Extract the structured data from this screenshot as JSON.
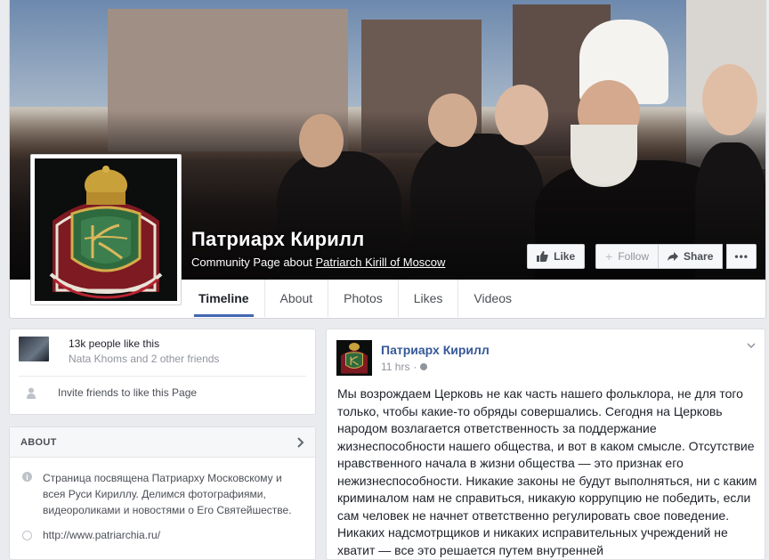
{
  "page": {
    "name": "Патриарх Кирилл",
    "subtitle_prefix": "Community Page about",
    "subtitle_link": "Patriarch Kirill of Moscow"
  },
  "actions": {
    "like": "Like",
    "follow": "Follow",
    "share": "Share",
    "more": "•••"
  },
  "tabs": [
    {
      "label": "Timeline",
      "active": true
    },
    {
      "label": "About"
    },
    {
      "label": "Photos"
    },
    {
      "label": "Likes"
    },
    {
      "label": "Videos"
    }
  ],
  "likes": {
    "count": "13k people like this",
    "friends": "Nata Khoms and 2 other friends",
    "invite": "Invite friends to like this Page"
  },
  "about": {
    "title": "ABOUT",
    "description": "Страница посвящена Патриарху Московскому и всея Руси Кириллу. Делимся фотографиями, видеороликами и новостями о Его Святейшестве.",
    "website": "http://www.patriarchia.ru/"
  },
  "post": {
    "author": "Патриарх Кирилл",
    "time": "11 hrs",
    "separator": "·",
    "text": "Мы возрождаем Церковь не как часть нашего фольклора, не для того только, чтобы какие-то обряды совершались. Сегодня на Церковь народом возлагается ответственность за поддержание жизнеспособности нашего общества, и вот в каком смысле. Отсутствие нравственного начала в жизни общества — это признак его нежизнеспособности. Никакие законы не будут выполняться, ни с каким криминалом нам не справиться, никакую коррупцию не победить, если сам человек не начнет ответственно регулировать свое поведение. Никаких надсмотрщиков и никаких исправительных учреждений не хватит — все это решается путем внутренней"
  },
  "colors": {
    "link_blue": "#365899",
    "tab_underline": "#4267b2",
    "page_bg": "#e9ebee"
  },
  "icons": {
    "like": "thumbs-up-icon",
    "follow": "plus-icon",
    "share": "share-arrow-icon",
    "more": "ellipsis-icon",
    "invite": "person-add-icon",
    "about_chevron": "chevron-right-icon",
    "info": "info-icon",
    "website": "globe-icon",
    "privacy": "public-globe-icon",
    "post_menu": "chevron-down-icon"
  }
}
